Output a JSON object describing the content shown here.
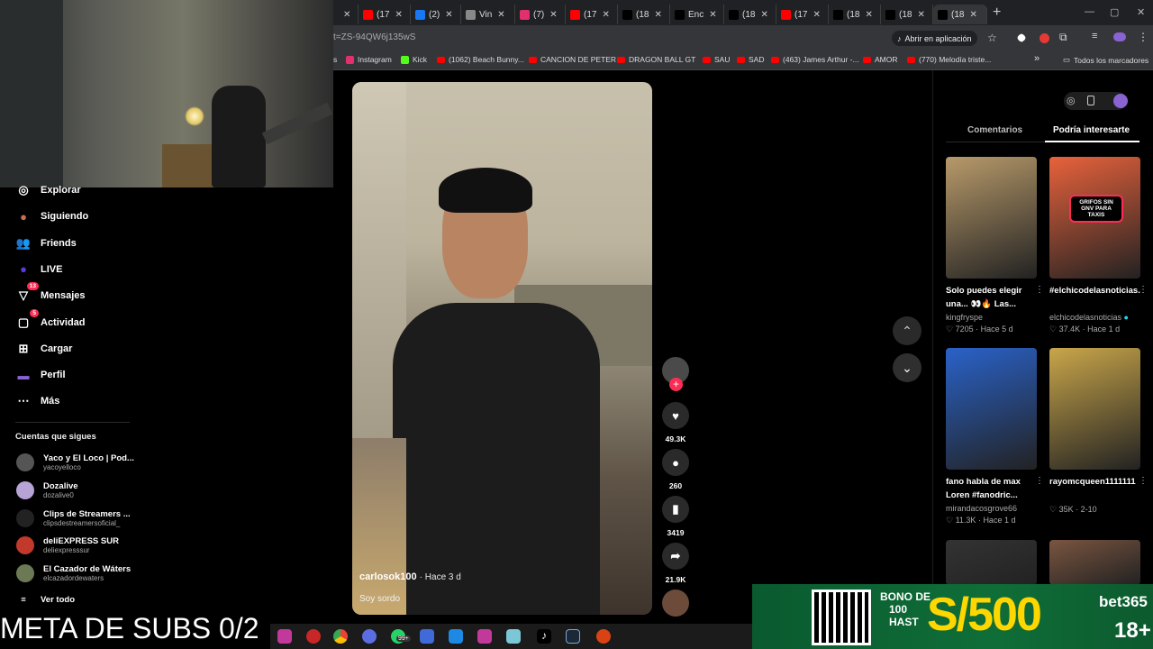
{
  "browser": {
    "tabs": [
      {
        "label": "",
        "fav": "#ff0000"
      },
      {
        "label": "(17",
        "fav": "#ff0000"
      },
      {
        "label": "(2)",
        "fav": "#1877f2"
      },
      {
        "label": "Vin",
        "fav": "#888888"
      },
      {
        "label": "(7)",
        "fav": "#e1306c"
      },
      {
        "label": "(17",
        "fav": "#ff0000"
      },
      {
        "label": "(18",
        "fav": "#000000"
      },
      {
        "label": "Enc",
        "fav": "#000000"
      },
      {
        "label": "(18",
        "fav": "#000000"
      },
      {
        "label": "(17",
        "fav": "#ff0000"
      },
      {
        "label": "(18",
        "fav": "#000000"
      },
      {
        "label": "(18",
        "fav": "#000000"
      },
      {
        "label": "(18",
        "fav": "#000000"
      }
    ],
    "add_tab": "+",
    "url": "t=ZS-94QW6j135wS",
    "open_app": "Abrir en aplicación",
    "bookmarks": [
      {
        "label": "s",
        "icon": "none"
      },
      {
        "label": "Instagram",
        "icon": "instagram"
      },
      {
        "label": "Kick",
        "icon": "kick"
      },
      {
        "label": "(1062) Beach Bunny...",
        "icon": "youtube"
      },
      {
        "label": "CANCION DE PETER",
        "icon": "youtube"
      },
      {
        "label": "DRAGON BALL GT",
        "icon": "youtube"
      },
      {
        "label": "SAU",
        "icon": "youtube"
      },
      {
        "label": "SAD",
        "icon": "youtube"
      },
      {
        "label": "(463) James Arthur -...",
        "icon": "youtube"
      },
      {
        "label": "AMOR",
        "icon": "youtube"
      },
      {
        "label": "(770) Melodía triste...",
        "icon": "youtube"
      }
    ],
    "more_bookmarks": "»",
    "all_bookmarks": "Todos los marcadores"
  },
  "sidebar": {
    "items": [
      {
        "label": "Explorar",
        "icon": "compass-icon",
        "badge": ""
      },
      {
        "label": "Siguiendo",
        "icon": "following-icon",
        "badge": ""
      },
      {
        "label": "Friends",
        "icon": "friends-icon",
        "badge": ""
      },
      {
        "label": "LIVE",
        "icon": "live-icon",
        "badge": ""
      },
      {
        "label": "Mensajes",
        "icon": "messages-icon",
        "badge": "13"
      },
      {
        "label": "Actividad",
        "icon": "activity-icon",
        "badge": "5"
      },
      {
        "label": "Cargar",
        "icon": "upload-icon",
        "badge": ""
      },
      {
        "label": "Perfil",
        "icon": "profile-icon",
        "badge": ""
      },
      {
        "label": "Más",
        "icon": "more-icon",
        "badge": ""
      }
    ],
    "following_title": "Cuentas que sigues",
    "accounts": [
      {
        "name": "Yaco y El Loco | Pod...",
        "handle": "yacoyelloco",
        "color": "#555555"
      },
      {
        "name": "Dozalive",
        "handle": "dozalive0",
        "color": "#b7a3d6"
      },
      {
        "name": "Clips de Streamers ...",
        "handle": "clipsdestreamersoficial_",
        "color": "#222222"
      },
      {
        "name": "deliEXPRESS SUR",
        "handle": "deliexpresssur",
        "color": "#c0392b"
      },
      {
        "name": "El Cazador de Wáters",
        "handle": "elcazadordewaters",
        "color": "#6b7a55"
      }
    ],
    "see_all": "Ver todo"
  },
  "video": {
    "author": "carlosok100",
    "time": "· Hace 3 d",
    "caption": "Soy sordo",
    "likes": "49.3K",
    "comments": "260",
    "saves": "3419",
    "shares": "21.9K"
  },
  "panel": {
    "tab_comments": "Comentarios",
    "tab_recommend": "Podría interesarte",
    "cards": [
      {
        "title": "Solo puedes elegir una... 👀🔥 Las...",
        "user": "kingfryspe",
        "likes": "7205",
        "age": "Hace 5 d",
        "bg": "#b89a6a"
      },
      {
        "title": "#elchicodelasnoticias...",
        "user": "elchicodelasnoticias",
        "likes": "37.4K",
        "age": "Hace 1 d",
        "bg": "#e8623c",
        "verified": true,
        "overlay": "GRIFOS SIN GNV PARA TAXIS"
      },
      {
        "title": "fano habla de max Loren #fanodric...",
        "user": "mirandacosgrove66",
        "likes": "11.3K",
        "age": "Hace 1 d",
        "bg": "#2a62c9"
      },
      {
        "title": "rayomcqueen1111111",
        "user": "",
        "likes": "35K",
        "age": "2-10",
        "bg": "#c9a64a"
      },
      {
        "title": "",
        "user": "",
        "likes": "",
        "age": "",
        "bg": "#333333"
      },
      {
        "title": "",
        "user": "",
        "likes": "",
        "age": "",
        "bg": "#7a5540"
      }
    ]
  },
  "overlay": {
    "meta_text": "META DE SUBS 0/2",
    "ad": {
      "bono": "BONO DE",
      "pct": "100",
      "hasta": "HAST",
      "amount": "S/500",
      "brand": "bet365",
      "age": "18+"
    }
  },
  "taskbar": {
    "badge": "99+"
  }
}
